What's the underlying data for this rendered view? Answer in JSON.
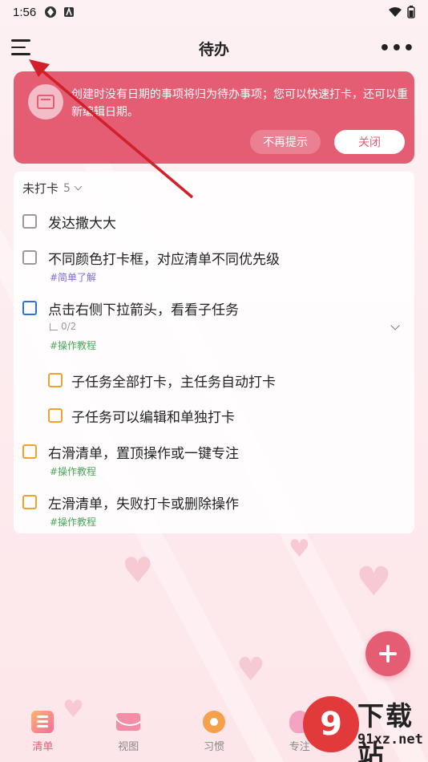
{
  "status_bar": {
    "time": "1:56"
  },
  "app_bar": {
    "title": "待办"
  },
  "banner": {
    "message": "创建时没有日期的事项将归为待办事项；您可以快速打卡，还可以重新编辑日期。",
    "dismiss_label": "不再提示",
    "close_label": "关闭"
  },
  "group": {
    "label": "未打卡",
    "count": "5"
  },
  "tasks": [
    {
      "title": "发达撒大大"
    },
    {
      "title": "不同颜色打卡框，对应清单不同优先级",
      "tag": "#简单了解"
    },
    {
      "title": "点击右侧下拉箭头，看看子任务",
      "subtasks": "0/2",
      "tag": "#操作教程"
    },
    {
      "title": "子任务全部打卡，主任务自动打卡"
    },
    {
      "title": "子任务可以编辑和单独打卡"
    },
    {
      "title": "右滑清单，置顶操作或一键专注",
      "tag": "#操作教程"
    },
    {
      "title": "左滑清单，失败打卡或删除操作",
      "tag": "#操作教程"
    }
  ],
  "bottom_nav": [
    {
      "label": "清单"
    },
    {
      "label": "视图"
    },
    {
      "label": "习惯"
    },
    {
      "label": "专注"
    }
  ],
  "watermark": {
    "title": "下载站",
    "url": "91xz.net",
    "logo_text": "9"
  },
  "colors": {
    "accent": "#e45d73",
    "priority_blue": "#2f6fe0",
    "priority_orange": "#f0a22c"
  }
}
